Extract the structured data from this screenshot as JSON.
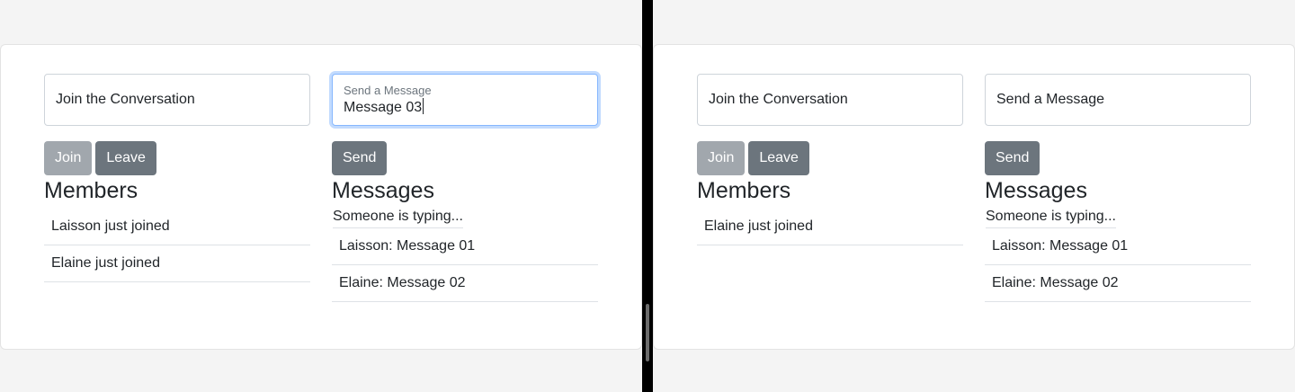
{
  "left": {
    "join_field": {
      "text": "Join the Conversation"
    },
    "message_field": {
      "label": "Send a Message",
      "value": "Message 03"
    },
    "buttons": {
      "join": "Join",
      "leave": "Leave",
      "send": "Send"
    },
    "members_title": "Members",
    "members": [
      "Laisson just joined",
      "Elaine just joined"
    ],
    "messages_title": "Messages",
    "typing": "Someone is typing...",
    "messages": [
      "Laisson: Message 01",
      "Elaine: Message 02"
    ]
  },
  "right": {
    "join_field": {
      "text": "Join the Conversation"
    },
    "message_field": {
      "placeholder": "Send a Message"
    },
    "buttons": {
      "join": "Join",
      "leave": "Leave",
      "send": "Send"
    },
    "members_title": "Members",
    "members": [
      "Elaine just joined"
    ],
    "messages_title": "Messages",
    "typing": "Someone is typing...",
    "messages": [
      "Laisson: Message 01",
      "Elaine: Message 02"
    ]
  }
}
